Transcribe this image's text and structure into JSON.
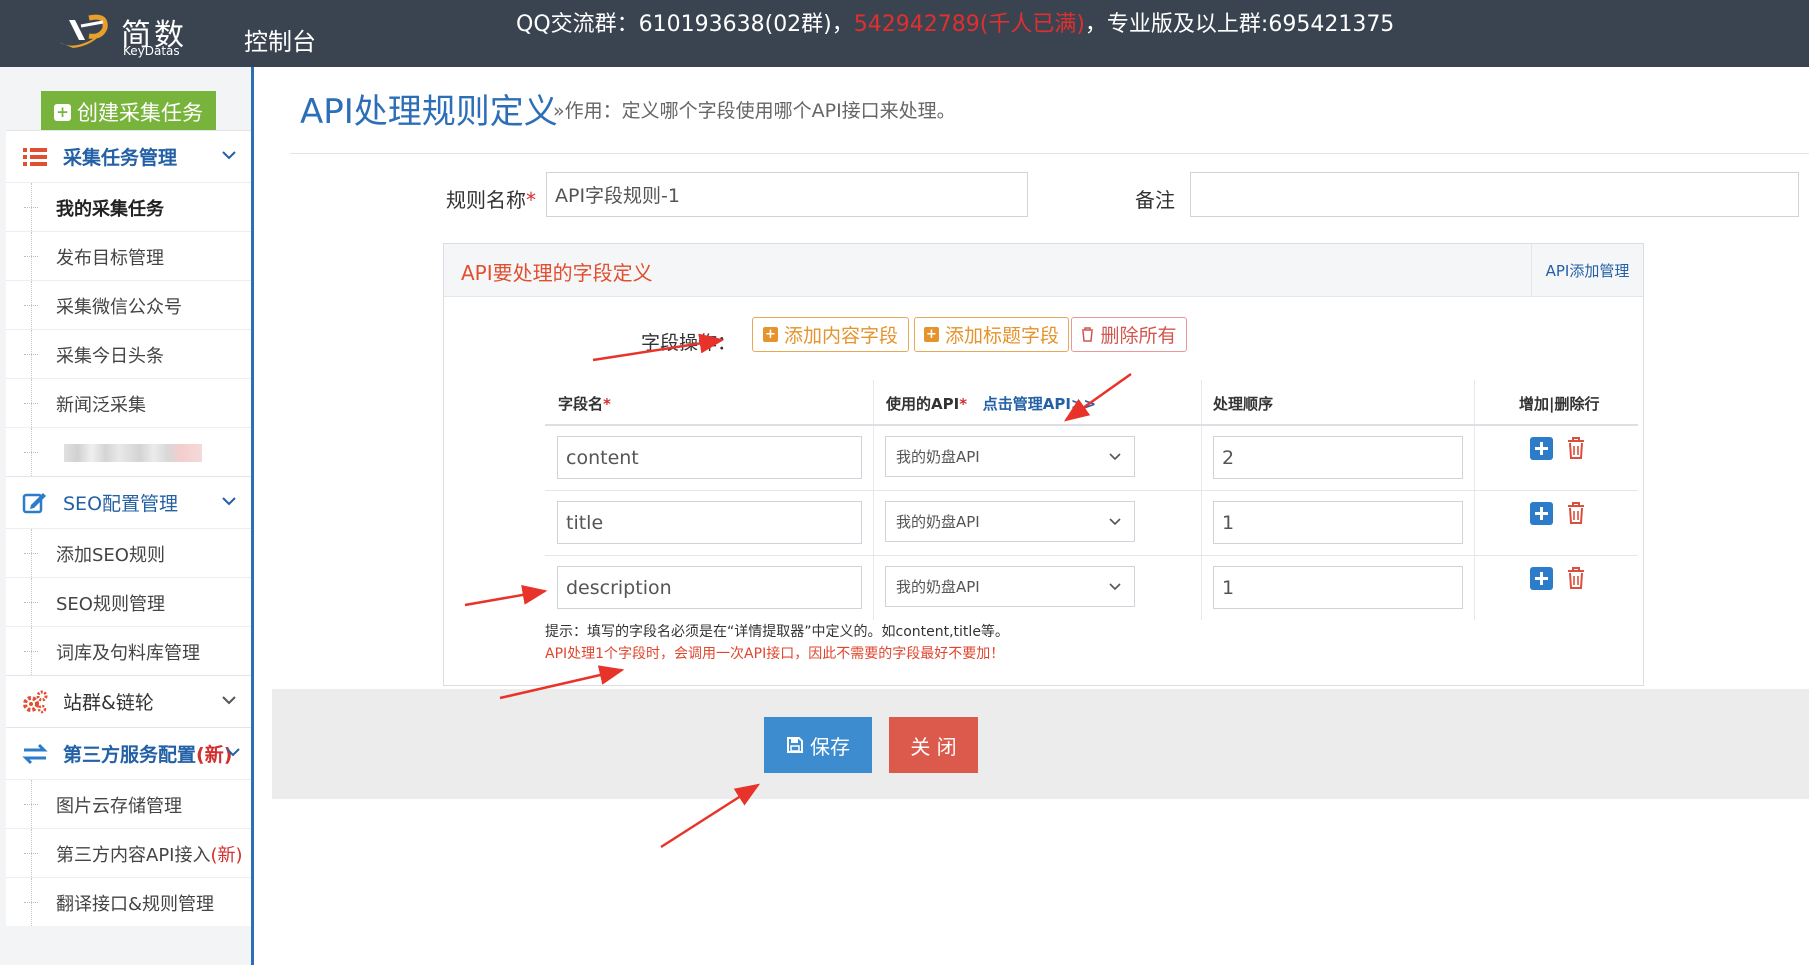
{
  "header": {
    "logo_cn": "简数",
    "logo_en": "KeyDatas",
    "console": "控制台",
    "notice_prefix": "QQ交流群：610193638(02群)，",
    "notice_red": "542942789(千人已满)",
    "notice_suffix": "，专业版及以上群:695421375"
  },
  "sidebar": {
    "create_button": "创建采集任务",
    "groups": [
      {
        "label": "采集任务管理",
        "icon": "list-icon"
      },
      {
        "label": "SEO配置管理",
        "icon": "edit-icon"
      },
      {
        "label": "站群&链轮",
        "icon": "gears-icon"
      },
      {
        "label": "第三方服务配置",
        "new": "(新)",
        "icon": "exchange-icon"
      }
    ],
    "items": [
      {
        "label": "我的采集任务"
      },
      {
        "label": "发布目标管理"
      },
      {
        "label": "采集微信公众号"
      },
      {
        "label": "采集今日头条"
      },
      {
        "label": "新闻泛采集"
      },
      {
        "label": "添加SEO规则"
      },
      {
        "label": "SEO规则管理"
      },
      {
        "label": "词库及句料库管理"
      },
      {
        "label": "图片云存储管理"
      },
      {
        "label": "第三方内容API接入",
        "new": "(新)"
      },
      {
        "label": "翻译接口&规则管理"
      }
    ]
  },
  "main": {
    "title": "API处理规则定义",
    "desc": "»作用：定义哪个字段使用哪个API接口来处理。",
    "rule_name_label": "规则名称",
    "rule_name_value": "API字段规则-1",
    "remark_label": "备注",
    "remark_value": "",
    "panel_title": "API要处理的字段定义",
    "panel_link": "API添加管理",
    "ops_label": "字段操作：",
    "btn_add_content": "添加内容字段",
    "btn_add_title": "添加标题字段",
    "btn_delete_all": "删除所有",
    "col_field": "字段名",
    "col_api": "使用的API",
    "col_api_link": "点击管理API>>",
    "col_order": "处理顺序",
    "col_ops": "增加|删除行",
    "rows": [
      {
        "field": "content",
        "api": "我的奶盘API",
        "order": "2"
      },
      {
        "field": "title",
        "api": "我的奶盘API",
        "order": "1"
      },
      {
        "field": "description",
        "api": "我的奶盘API",
        "order": "1"
      }
    ],
    "hint1": "提示：填写的字段名必须是在“详情提取器”中定义的。如content,title等。",
    "hint2": "API处理1个字段时，会调用一次API接口，因此不需要的字段最好不要加！",
    "save": "保存",
    "close": "关 闭"
  },
  "colors": {
    "header_bg": "#3a4450",
    "accent_blue": "#2d6fb7",
    "green": "#78b43c",
    "red": "#db5a4b",
    "arrow": "#e8332a"
  }
}
